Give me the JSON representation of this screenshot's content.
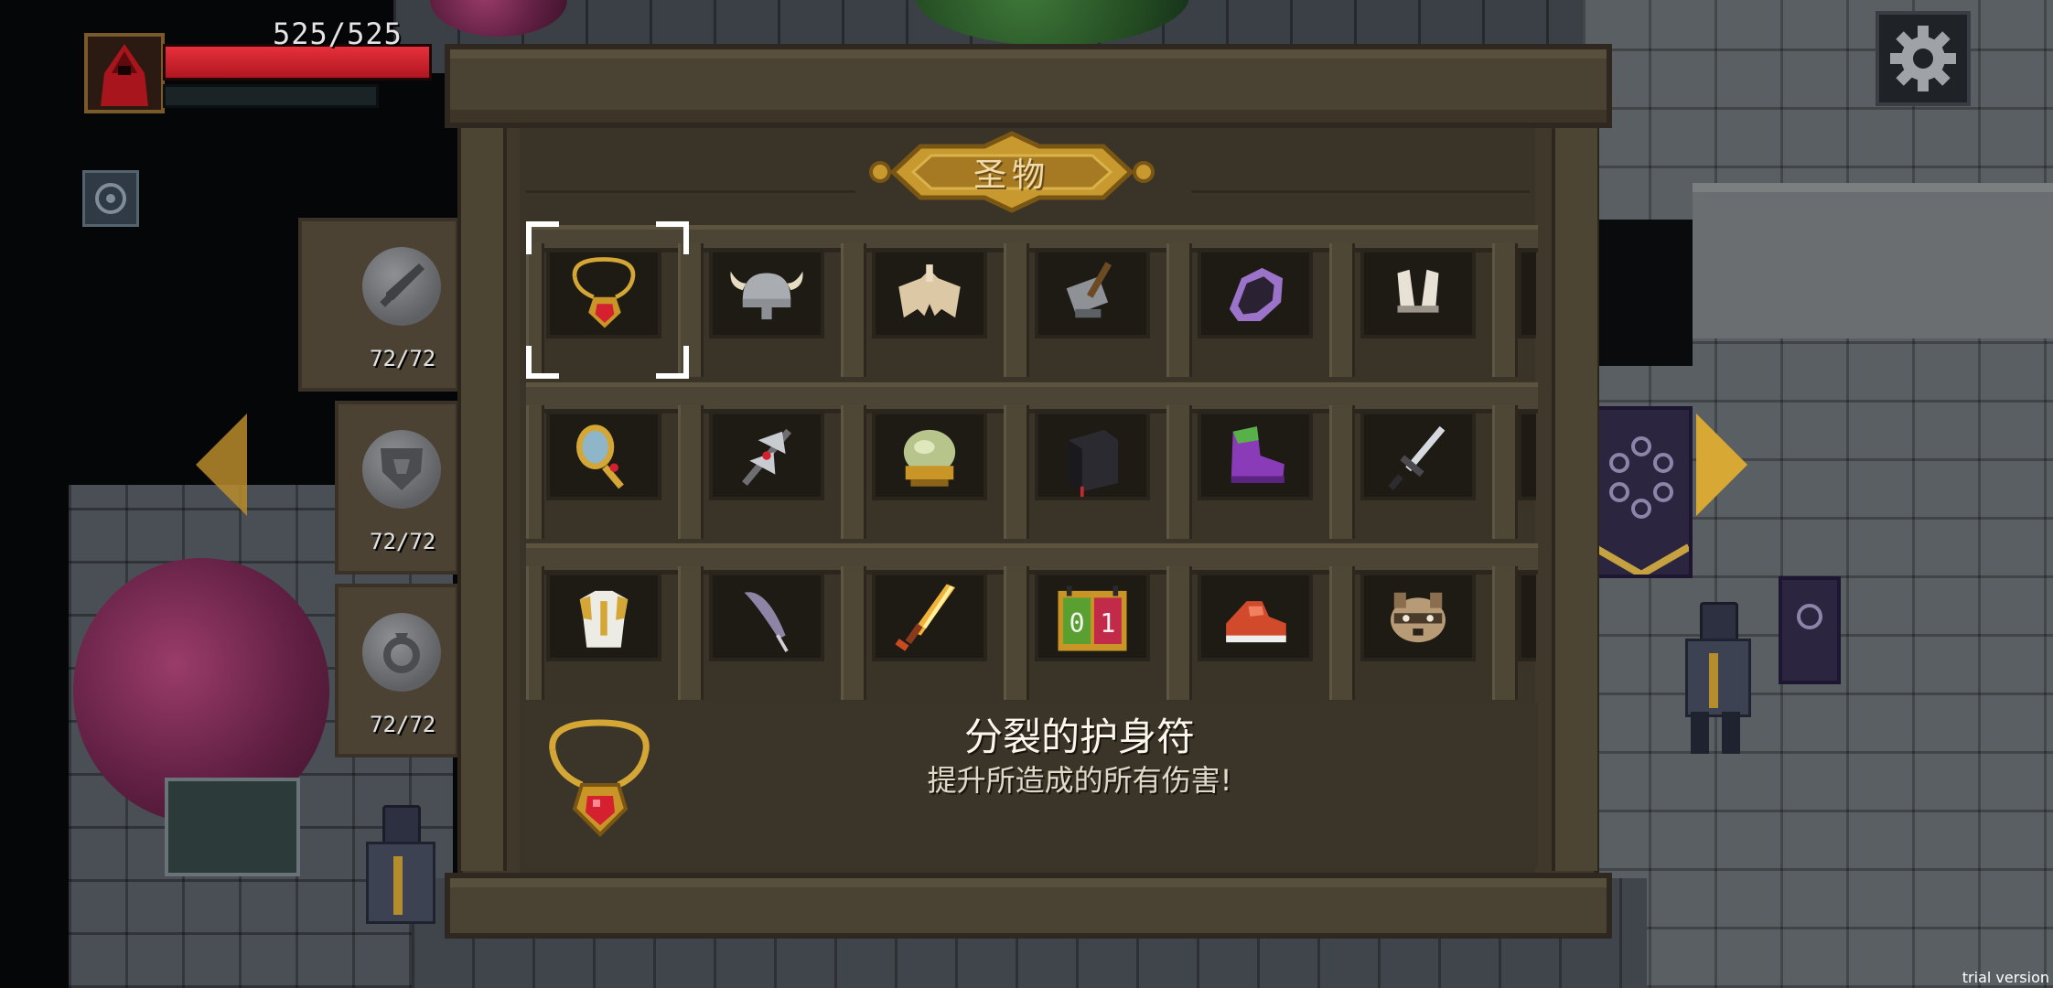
{
  "hud": {
    "hp_text": "525/525",
    "hp_fraction": 1.0,
    "portrait_icon": "red-hooded-wizard-icon",
    "skill_icon": "cog-rune-icon",
    "settings_icon": "gear-icon"
  },
  "side_tabs": [
    {
      "icon": "sword-emblem-icon",
      "count": "72/72"
    },
    {
      "icon": "shield-emblem-icon",
      "count": "72/72"
    },
    {
      "icon": "ring-emblem-icon",
      "count": "72/72"
    }
  ],
  "panel": {
    "title": "圣物",
    "selected_index": 0
  },
  "relics": [
    [
      {
        "name": "amulet",
        "icon": "red-gem-amulet-icon"
      },
      {
        "name": "viking-helmet",
        "icon": "horned-helmet-icon"
      },
      {
        "name": "bone-wings",
        "icon": "bone-wings-icon"
      },
      {
        "name": "hammer",
        "icon": "war-hammer-icon"
      },
      {
        "name": "shadow-claw",
        "icon": "purple-claw-icon"
      },
      {
        "name": "rabbit-ears",
        "icon": "bunny-ears-icon"
      }
    ],
    [
      {
        "name": "hand-mirror",
        "icon": "hand-mirror-icon"
      },
      {
        "name": "battle-axe",
        "icon": "double-axe-icon"
      },
      {
        "name": "crystal-orb",
        "icon": "crystal-orb-icon"
      },
      {
        "name": "black-book",
        "icon": "black-tome-icon"
      },
      {
        "name": "purple-boot",
        "icon": "purple-boot-icon"
      },
      {
        "name": "dagger",
        "icon": "dagger-icon"
      }
    ],
    [
      {
        "name": "gold-armor",
        "icon": "gold-armor-icon"
      },
      {
        "name": "feather",
        "icon": "quill-feather-icon"
      },
      {
        "name": "flaming-sword",
        "icon": "flame-sword-icon"
      },
      {
        "name": "counter",
        "icon": "counter-icon",
        "digits": [
          "0",
          "1"
        ]
      },
      {
        "name": "red-sneaker",
        "icon": "red-sneaker-icon"
      },
      {
        "name": "raccoon",
        "icon": "raccoon-head-icon"
      }
    ]
  ],
  "detail": {
    "name": "分裂的护身符",
    "description": "提升所造成的所有伤害!",
    "icon": "red-gem-amulet-icon"
  },
  "colors": {
    "hp_red": "#d92632",
    "gold": "#d8a834",
    "wood": "#4a4232"
  },
  "watermark": "trial version"
}
